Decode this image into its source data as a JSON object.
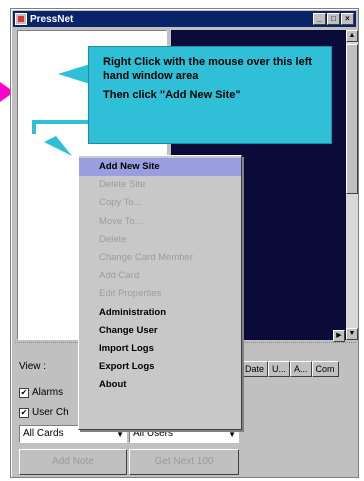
{
  "window": {
    "title": "PressNet",
    "controls": [
      "_",
      "□",
      "×"
    ]
  },
  "callout": {
    "line1": "Right Click with the mouse over this left hand window area",
    "line2": "Then click \"Add New Site\""
  },
  "context_menu": {
    "items": [
      {
        "label": "Add New Site",
        "state": "highlighted"
      },
      {
        "label": "Delete Site",
        "state": "disabled"
      },
      {
        "label": "Copy To...",
        "state": "disabled"
      },
      {
        "label": "Move To...",
        "state": "disabled"
      },
      {
        "label": "Delete",
        "state": "disabled"
      },
      {
        "label": "Change Card Member",
        "state": "disabled"
      },
      {
        "label": "Add Card",
        "state": "disabled"
      },
      {
        "label": "Edit Properties",
        "state": "disabled"
      },
      {
        "label": "Administration",
        "state": "enabled"
      },
      {
        "label": "Change User",
        "state": "enabled"
      },
      {
        "label": "Import Logs",
        "state": "enabled"
      },
      {
        "label": "Export Logs",
        "state": "enabled"
      },
      {
        "label": "About",
        "state": "enabled"
      }
    ]
  },
  "lower": {
    "view_label": "View :",
    "columns": [
      "Date",
      "U...",
      "A...",
      "Com"
    ],
    "checks": [
      {
        "label": "Alarms",
        "checked": true
      },
      {
        "label": "User Ch",
        "checked": true
      }
    ],
    "cards_select": "All Cards",
    "users_select": "All Users",
    "add_note_button": "Add Note",
    "get_next_button": "Get Next 100"
  },
  "colors": {
    "title_bar": "#0a246a",
    "callout": "#2fbfd6",
    "pointer_arrow": "#ff00cc",
    "menu_highlight": "#9a9ee0",
    "right_pane": "#0b0b3a"
  }
}
